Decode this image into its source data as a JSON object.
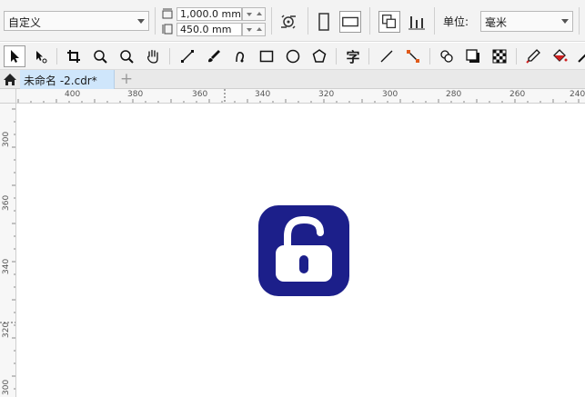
{
  "property_bar": {
    "preset": "自定义",
    "width": "1,000.0 mm",
    "height": "450.0 mm",
    "units_label": "单位:",
    "units_value": "毫米"
  },
  "toolbar": {
    "text_tool_glyph": "字"
  },
  "document_tabs": [
    {
      "title": "未命名 -2.cdr*",
      "active": true
    }
  ],
  "new_tab_glyph": "+",
  "ruler": {
    "horizontal_labels": [
      "400",
      "380",
      "360",
      "340",
      "320",
      "300",
      "280",
      "260",
      "240"
    ],
    "vertical_labels": [
      "300",
      "360",
      "340",
      "320",
      "300"
    ]
  },
  "canvas": {
    "object": "unlock-icon",
    "tile_color": "#1c1f8a",
    "glyph_color": "#ffffff"
  }
}
